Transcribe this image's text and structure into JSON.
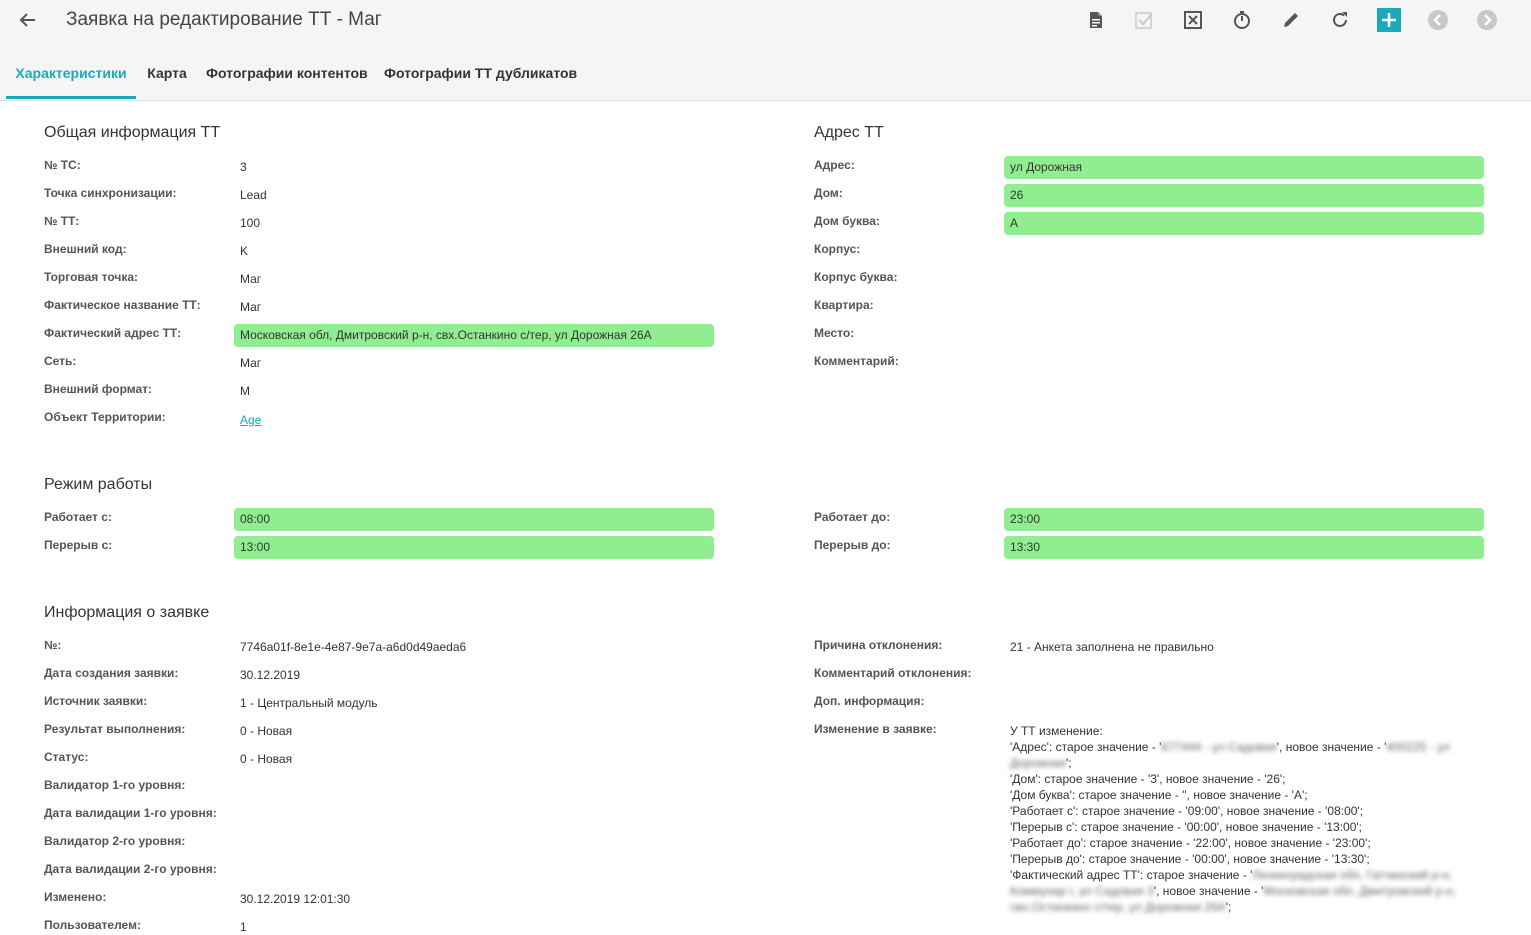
{
  "header": {
    "title": "Заявка на редактирование ТТ - Маг",
    "accent": "#1aa9b9",
    "icons": [
      "document-icon",
      "check-icon",
      "close-box-icon",
      "timer-icon",
      "pencil-icon",
      "refresh-icon",
      "plus-icon",
      "arrow-left-circle-icon",
      "arrow-right-circle-icon"
    ]
  },
  "tabs": [
    {
      "label": "Характеристики",
      "active": true
    },
    {
      "label": "Карта"
    },
    {
      "label": "Фотографии контентов"
    },
    {
      "label": "Фотографии ТТ дубликатов"
    }
  ],
  "general": {
    "title": "Общая информация ТТ",
    "fields": [
      {
        "label": "№ ТС:",
        "value": "3"
      },
      {
        "label": "Точка синхронизации:",
        "value": "Lead"
      },
      {
        "label": "№ ТТ:",
        "value": "100"
      },
      {
        "label": "Внешний код:",
        "value": "K"
      },
      {
        "label": "Торговая точка:",
        "value": "Маг"
      },
      {
        "label": "Фактическое название ТТ:",
        "value": "Маг"
      },
      {
        "label": "Фактический адрес ТТ:",
        "value": "Московская обл, Дмитровский р-н, свх.Останкино с/тер, ул Дорожная 26А"
      },
      {
        "label": "Сеть:",
        "value": "Маг"
      },
      {
        "label": "Внешний формат:",
        "value": "M"
      },
      {
        "label": "Объект Территории:",
        "value": "Age"
      }
    ]
  },
  "address": {
    "title": "Адрес ТТ",
    "fields": [
      {
        "label": "Адрес:",
        "value": "ул Дорожная"
      },
      {
        "label": "Дом:",
        "value": "26"
      },
      {
        "label": "Дом буква:",
        "value": "А"
      },
      {
        "label": "Корпус:",
        "value": ""
      },
      {
        "label": "Корпус буква:",
        "value": ""
      },
      {
        "label": "Квартира:",
        "value": ""
      },
      {
        "label": "Место:",
        "value": ""
      },
      {
        "label": "Комментарий:",
        "value": ""
      }
    ]
  },
  "schedule": {
    "title": "Режим работы",
    "works_from": {
      "label": "Работает с:",
      "value": "08:00"
    },
    "break_from": {
      "label": "Перерыв с:",
      "value": "13:00"
    },
    "works_to": {
      "label": "Работает до:",
      "value": "23:00"
    },
    "break_to": {
      "label": "Перерыв до:",
      "value": "13:30"
    }
  },
  "request": {
    "title": "Информация о заявке",
    "left": [
      {
        "label": "№:",
        "value": "7746a01f-8e1e-4e87-9e7a-a6d0d49aeda6"
      },
      {
        "label": "Дата создания заявки:",
        "value": "30.12.2019"
      },
      {
        "label": "Источник заявки:",
        "value": "1 - Центральный модуль"
      },
      {
        "label": "Результат выполнения:",
        "value": "0 - Новая"
      },
      {
        "label": "Статус:",
        "value": "0 - Новая"
      },
      {
        "label": "Валидатор 1-го уровня:",
        "value": ""
      },
      {
        "label": "Дата валидации 1-го уровня:",
        "value": ""
      },
      {
        "label": "Валидатор 2-го уровня:",
        "value": ""
      },
      {
        "label": "Дата валидации 2-го уровня:",
        "value": ""
      },
      {
        "label": "Изменено:",
        "value": "30.12.2019 12:01:30"
      },
      {
        "label": "Пользователем:",
        "value": "1"
      }
    ],
    "right": [
      {
        "label": "Причина отклонения:",
        "value": "21 - Анкета заполнена не правильно"
      },
      {
        "label": "Комментарий отклонения:",
        "value": ""
      },
      {
        "label": "Доп. информация:",
        "value": ""
      },
      {
        "label": "Изменение в заявке:",
        "value": ""
      }
    ],
    "changes": {
      "l0": "У ТТ изменение:",
      "l1a": "'Адрес': старое значение - '",
      "l1b": "677444 - ул Садовая",
      "l1c": "', новое значение - '",
      "l1d": "400225 - ул",
      "l2a": "Дорожная",
      "l2b": "';",
      "l3": "'Дом': старое значение - '3', новое значение - '26';",
      "l4": "'Дом буква': старое значение - '', новое значение - 'А';",
      "l5": "'Работает с': старое значение - '09:00', новое значение - '08:00';",
      "l6": "'Перерыв с': старое значение - '00:00', новое значение - '13:00';",
      "l7": "'Работает до': старое значение - '22:00', новое значение - '23:00';",
      "l8": "'Перерыв до': старое значение - '00:00', новое значение - '13:30';",
      "l9a": "'Фактический адрес ТТ': старое значение - '",
      "l9b": "Ленинградская обл, Гатчинский р-н,",
      "l10a": "Коммунар г, ул Садовая 3",
      "l10b": "', новое значение - '",
      "l10c": "Московская обл, Дмитровский р-н,",
      "l11a": "свх.Останкино с/тер, ул Дорожная 26А",
      "l11b": "';"
    }
  }
}
